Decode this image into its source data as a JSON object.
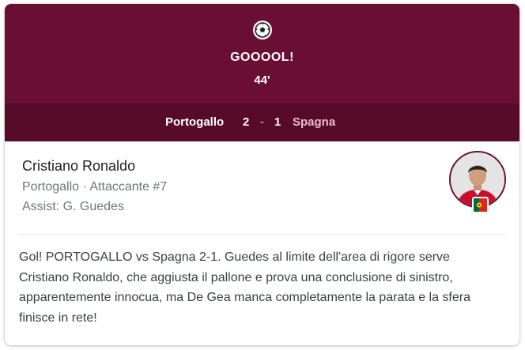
{
  "header": {
    "title": "GOOOOL!",
    "minute": "44'",
    "icon": "soccer-ball-icon",
    "background_color": "#6b0e33"
  },
  "scoreboard": {
    "home_team": "Portogallo",
    "home_score": "2",
    "separator": "-",
    "away_score": "1",
    "away_team": "Spagna",
    "background_color": "#580a29"
  },
  "player": {
    "name": "Cristiano Ronaldo",
    "meta": "Portogallo · Attaccante #7",
    "assist": "Assist: G. Guedes",
    "avatar_icon": "player-avatar",
    "flag_icon": "portugal-flag-icon"
  },
  "description": "Gol! PORTOGALLO vs Spagna 2-1. Guedes al limite dell'area di rigore serve Cristiano Ronaldo, che aggiusta il pallone e prova una conclusione di sinistro, apparentemente innocua, ma De Gea manca completamente la parata e la sfera finisce in rete!"
}
